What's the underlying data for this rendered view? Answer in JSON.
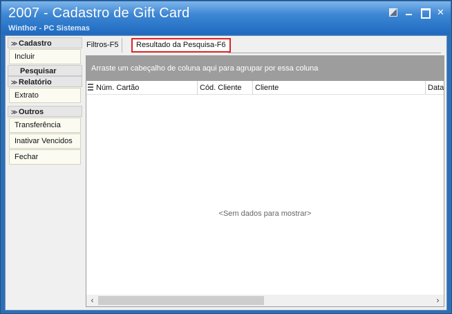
{
  "window": {
    "title": "2007 - Cadastro de Gift Card",
    "subtitle": "Winthor - PC Sistemas"
  },
  "sidebar": {
    "groups": [
      {
        "header": "Cadastro",
        "items": [
          "Incluir"
        ]
      },
      {
        "header": "Pesquisar",
        "items": []
      },
      {
        "header": "Relatório",
        "items": [
          "Extrato"
        ]
      },
      {
        "header": "Outros",
        "items": [
          "Transferência",
          "Inativar Vencidos",
          "Fechar"
        ]
      }
    ]
  },
  "tabs": [
    {
      "label": "Filtros-F5"
    },
    {
      "label": "Resultado da Pesquisa-F6"
    }
  ],
  "grid": {
    "group_panel_text": "Arraste um cabeçalho de coluna aqui para agrupar por essa coluna",
    "columns": [
      "Núm. Cartão",
      "Cód. Cliente",
      "Cliente",
      "Data"
    ],
    "empty_text": "<Sem dados para mostrar>"
  },
  "icons": {
    "scroll_left": "‹",
    "scroll_right": "›",
    "collapse": "≫"
  },
  "colors": {
    "titlebar": "#2a78cc",
    "highlight_tab_border": "#e02020",
    "group_panel": "#9d9d9d"
  }
}
